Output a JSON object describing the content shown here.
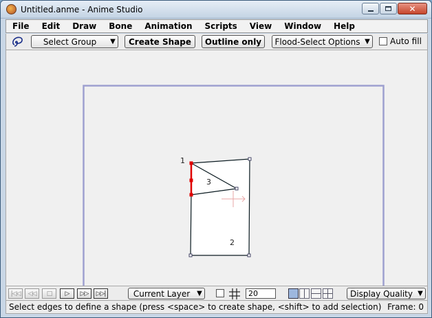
{
  "window": {
    "title": "Untitled.anme - Anime Studio"
  },
  "menu": [
    "File",
    "Edit",
    "Draw",
    "Bone",
    "Animation",
    "Scripts",
    "View",
    "Window",
    "Help"
  ],
  "toolbar": {
    "tool_icon": "lasso-icon",
    "select_group": "Select Group",
    "create_shape": "Create Shape",
    "outline_only": "Outline only",
    "flood_select": "Flood-Select Options",
    "auto_fill": "Auto fill",
    "auto_fill_checked": false
  },
  "canvas": {
    "shape_labels": [
      "1",
      "2",
      "3"
    ]
  },
  "bottom": {
    "layer_select": "Current Layer",
    "grid_size": "20",
    "display_quality": "Display Quality",
    "playback_icons": [
      "rewind-icon",
      "step-back-icon",
      "stop-icon",
      "play-icon",
      "step-forward-icon",
      "fast-forward-icon"
    ]
  },
  "status": {
    "message": "Select edges to define a shape (press <space> to create shape, <shift> to add selection)",
    "frame": "Frame: 0"
  },
  "colors": {
    "selection": "#e00000",
    "frame_border": "#9ea0cf",
    "accent": "#9db7de"
  }
}
